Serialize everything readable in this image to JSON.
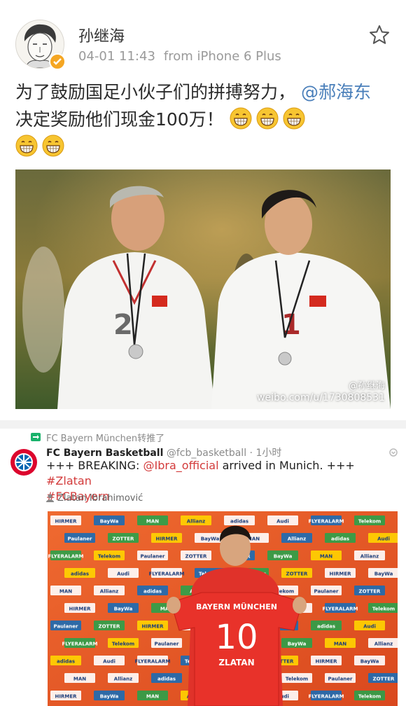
{
  "weibo": {
    "username": "孙继海",
    "timestamp": "04-01 11:43",
    "source": "from iPhone 6 Plus",
    "text_part1": "为了鼓励国足小伙子们的拼搏努力，",
    "mention": "@郝海东",
    "text_part2": "决定奖励他们现金100万！",
    "emoji_count": 5,
    "watermark_name": "@孙继海",
    "watermark_url": "weibo.com/u/1730808531",
    "icons": {
      "favorite": "star-icon",
      "verified": "verified-badge-icon"
    },
    "colors": {
      "mention": "#4a7fba",
      "verified": "#f5a623"
    }
  },
  "tweet": {
    "retweet_label": "FC Bayern München转推了",
    "name": "FC Bayern Basketball",
    "handle": "@fcb_basketball",
    "time": "· 1小时",
    "body_prefix": "+++ BREAKING: ",
    "body_mention": "@Ibra_official",
    "body_middle": " arrived in Munich. +++ ",
    "hashtag1": "#Zlatan",
    "hashtag2": "#FCBayern",
    "tagged_user": "Zlatan Ibrahimović",
    "colors": {
      "link": "#d33b3b"
    }
  },
  "photo2_board": {
    "sponsors": [
      "HIRMER",
      "BayWa",
      "MAN",
      "Allianz",
      "adidas",
      "Audi",
      "FLYERALARM",
      "Telekom",
      "Paulaner",
      "ZOTTER"
    ],
    "shirt_top": "BAYERN MÜNCHEN",
    "shirt_number": "10",
    "shirt_name": "ZLATAN"
  }
}
